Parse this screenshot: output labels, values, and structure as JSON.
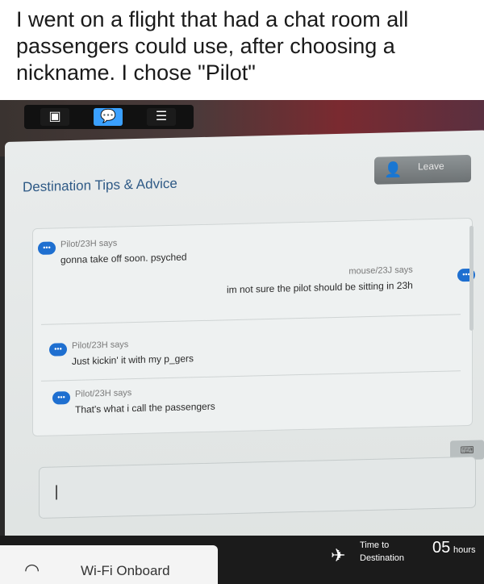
{
  "caption": "I went on a flight that had a chat room all passengers could use, after choosing a nickname. I chose \"Pilot\"",
  "colors": {
    "accent_blue": "#2f5a86",
    "bubble_blue": "#1e6fd0"
  },
  "topbar": {
    "icons": [
      "monitor-icon",
      "chat-icon",
      "server-icon"
    ]
  },
  "chat": {
    "title": "Destination Tips & Advice",
    "leave_label": "Leave",
    "messages": [
      {
        "sender": "Pilot/23H says",
        "text": "gonna take off soon. psyched"
      },
      {
        "sender": "mouse/23J says",
        "text": "im not sure the pilot should be sitting in 23h"
      },
      {
        "sender": "Pilot/23H says",
        "text": "Just kickin' it with my p_gers"
      },
      {
        "sender": "Pilot/23H says",
        "text": "That's what i call the passengers"
      }
    ]
  },
  "footer": {
    "wifi_label": "Wi-Fi Onboard",
    "time_to_destination_label": "Time to Destination",
    "time_value": "05",
    "time_unit": "hours"
  }
}
